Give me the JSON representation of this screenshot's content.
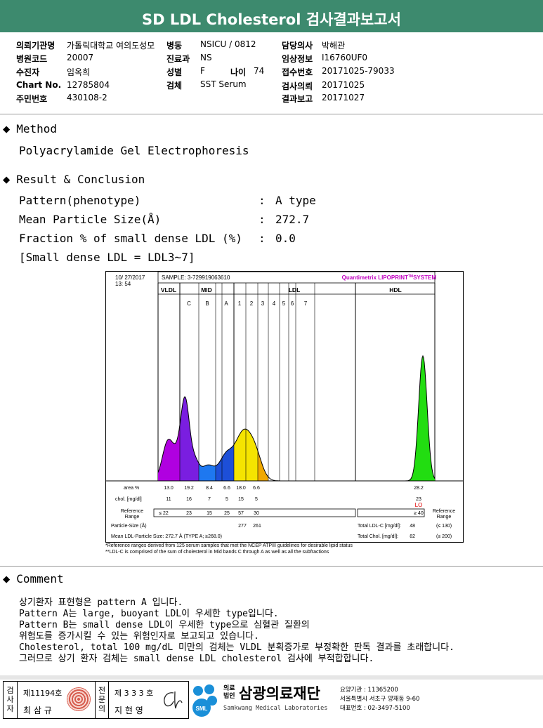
{
  "title": "SD LDL Cholesterol 검사결과보고서",
  "info": {
    "hospital_label": "의뢰기관명",
    "hospital_value": "가톨릭대학교 여의도성모",
    "ward_label": "병동",
    "ward_value": "NSICU / 0812",
    "doctor_label": "담당의사",
    "doctor_value": "박해관",
    "code_label": "병원코드",
    "code_value": "20007",
    "dept_label": "진료과",
    "dept_value": "NS",
    "clinical_label": "임상정보",
    "clinical_value": "I16760UF0",
    "patient_label": "수진자",
    "patient_value": "임옥희",
    "sex_label": "성별",
    "sex_value": "F",
    "age_label": "나이",
    "age_value": "74",
    "accession_label": "접수번호",
    "accession_value": "20171025-79033",
    "chart_label": "Chart No.",
    "chart_value": "12785804",
    "specimen_label": "검체",
    "specimen_value": "SST Serum",
    "request_label": "검사의뢰",
    "request_value": "20171025",
    "id_label": "주민번호",
    "id_value": "430108-2",
    "report_label": "결과보고",
    "report_value": "20171027"
  },
  "method": {
    "heading": "Method",
    "text": "Polyacrylamide Gel Electrophoresis"
  },
  "result": {
    "heading": "Result & Conclusion",
    "rows": [
      {
        "label": "Pattern(phenotype)",
        "colon": ":",
        "value": "A type"
      },
      {
        "label": "Mean Particle Size(Å)",
        "colon": ":",
        "value": "272.7"
      },
      {
        "label": "Fraction % of small dense LDL (%)",
        "colon": ":",
        "value": "0.0"
      }
    ],
    "note": "[Small dense LDL = LDL3~7]"
  },
  "chart": {
    "date": "10/ 27/2017",
    "time": "13: 54",
    "sample": "SAMPLE:   3-729919063610",
    "system": "Quantimetrix LIPOPRINT",
    "system_tm": "TM",
    "system_suffix": "SYSTEM",
    "group_vldl": "VLDL",
    "group_mid": "MID",
    "group_ldl": "LDL",
    "group_hdl": "HDL",
    "bands": [
      "C",
      "B",
      "A",
      "1",
      "2",
      "3",
      "4",
      "5",
      "6",
      "7"
    ],
    "area_label": "area %",
    "area_values": [
      "13.0",
      "19.2",
      "8.4",
      "6.6",
      "18.0",
      "6.6",
      "28.2"
    ],
    "chol_label": "chol. [mg/dl]",
    "chol_values": [
      "11",
      "16",
      "7",
      "5",
      "15",
      "5",
      "23"
    ],
    "lo_flag": "LO",
    "ref_label_1": "Reference",
    "ref_label_2": "Range",
    "ref_values": [
      "≤ 22",
      "23",
      "15",
      "25",
      "57",
      "30"
    ],
    "ref_hdl": "≥ 40",
    "particle_label": "Particle-Size (Å)",
    "particle_values": [
      "277",
      "261"
    ],
    "total_ldl_label": "Total LDL-C [mg/dl]:",
    "total_ldl_value": "48",
    "total_ldl_ref": "(≤ 130)",
    "mean_ldl": "Mean LDL-Particle Size:   272.7 Å   (TYPE A; ≥268.0)",
    "total_chol_label": "Total Chol. [mg/dl]:",
    "total_chol_value": "82",
    "total_chol_ref": "(≤ 200)"
  },
  "chart_footnote_1": "*Reference ranges derived from 125 serum samples that met the NCEP ATPIII guidelines for desirable lipid status",
  "chart_footnote_2": "**LDL-C is comprised of the sum of cholesterol in Mid bands C through A as well as all the subfractions",
  "chart_data": {
    "type": "area",
    "x_groups": [
      "VLDL",
      "MID",
      "LDL",
      "HDL"
    ],
    "bands": [
      "VLDL",
      "C",
      "B",
      "A",
      "1",
      "2",
      "3",
      "4",
      "5",
      "6",
      "7",
      "HDL"
    ],
    "area_percent": {
      "VLDL": 13.0,
      "C": 19.2,
      "B": 8.4,
      "A": 6.6,
      "1": 18.0,
      "2": 6.6,
      "HDL": 28.2
    },
    "cholesterol_mg_dl": {
      "VLDL": 11,
      "C": 16,
      "B": 7,
      "A": 5,
      "1": 15,
      "2": 5,
      "HDL": 23
    },
    "colors": {
      "VLDL": "#b000e0",
      "C": "#7a1ee0",
      "B": "#1e78f0",
      "A": "#1d4fd8",
      "1": "#f5e400",
      "2": "#f0a800",
      "HDL": "#22dd11"
    }
  },
  "comment": {
    "heading": "Comment",
    "lines": [
      "상기환자 표현형은 pattern A 입니다.",
      "Pattern A는 large, buoyant LDL이 우세한 type입니다.",
      "Pattern B는 small dense LDL이 우세한 type으로 심혈관 질환의",
      "위험도를 증가시킬 수 있는 위험인자로 보고되고 있습니다.",
      "Cholesterol, total 100 mg/dL 미만의 검체는 VLDL 분획증가로 부정확한 판독 결과를 초래합니다.",
      "그러므로 상기 환자 검체는 small dense LDL cholesterol 검사에 부적합합니다."
    ]
  },
  "footer": {
    "left_label": "검사자",
    "left_license": "제11194호",
    "left_name": "최 삼 규",
    "mid_label": "전문의",
    "mid_license": "제 3 3 3 호",
    "mid_name": "지 현 영",
    "org_prefix_1": "의료",
    "org_prefix_2": "법인",
    "org_name": "삼광의료재단",
    "org_english": "Samkwang Medical Laboratories",
    "logo_text": "SML",
    "line1": "요양기관 : 11365200",
    "line2": "서울특별시 서초구 양재동 9-60",
    "line3": "대표번호 : 02-3497-5100"
  }
}
